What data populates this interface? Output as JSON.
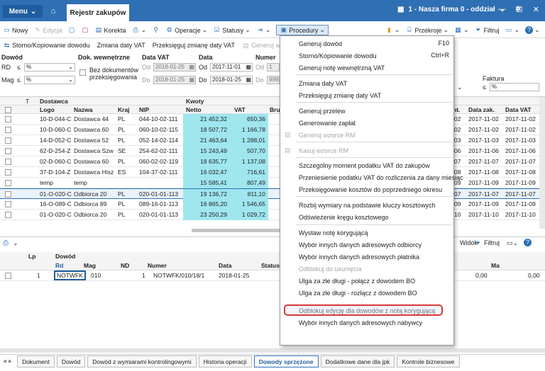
{
  "titlebar": {
    "menu": "Menu",
    "tab": "Rejestr zakupów",
    "company": "1 - Nasza firma 0 - oddział"
  },
  "toolbar": {
    "items": [
      "Nowy",
      "Edycja",
      "Korekta",
      "Operacje",
      "Statusy",
      "Procedury",
      "Przekroje",
      "Filtruj"
    ]
  },
  "toolbar2": {
    "items": [
      "Storno/Kopiowanie dowodu",
      "Zmiana daty VAT",
      "Przeksięguj zmianę daty VAT",
      "Generuj wzorce RM"
    ]
  },
  "filters": {
    "dowod": "Dowód",
    "dok_wew": "Dok. wewnętrzne",
    "data_vat": "Data VAT",
    "data": "Data",
    "numer": "Numer",
    "rd": "RD",
    "mag": "Mag",
    "le": "≤",
    "pct": "%",
    "bez": "Bez dokumentów przeksięgowania",
    "od": "Od",
    "do": "Do",
    "dv_od": "2018-01-25",
    "dv_do": "2018-01-25",
    "d_od": "2017-11-01",
    "d_do": "2018-01-25",
    "num_od": "1",
    "num_do": "999",
    "faktura": "Faktura"
  },
  "grid": {
    "group_hdr": {
      "dostawca": "Dostawca",
      "kwoty": "Kwoty"
    },
    "headers": {
      "t": "T",
      "logo": "Logo",
      "nazwa": "Nazwa",
      "kraj": "Kraj",
      "nip": "NIP",
      "netto": "Netto",
      "vat": "VAT",
      "bru": "Bru",
      "dnr": "nt.",
      "data_zak": "Data zak.",
      "data_vat": "Data VAT"
    },
    "rows": [
      {
        "logo": "10-D-044-C",
        "nazwa": "Dostawca 44",
        "kraj": "PL",
        "nip": "044-10-02-111",
        "netto": "21 452,32",
        "vat": "650,36",
        "dn": "02",
        "dz": "2017-11-02",
        "dv": "2017-11-02"
      },
      {
        "logo": "10-D-060-C",
        "nazwa": "Dostawca 60",
        "kraj": "PL",
        "nip": "060-10-02-115",
        "netto": "18 507,72",
        "vat": "1 166,78",
        "dn": "02",
        "dz": "2017-11-02",
        "dv": "2017-11-02"
      },
      {
        "logo": "14-D-052-C",
        "nazwa": "Dostawca 52",
        "kraj": "PL",
        "nip": "052-14-02-114",
        "netto": "21 463,64",
        "vat": "1 288,01",
        "dn": "03",
        "dz": "2017-11-03",
        "dv": "2017-11-03"
      },
      {
        "logo": "62-D-254-Z",
        "nazwa": "Dostawca Szw",
        "kraj": "SE",
        "nip": "254-62-02-111",
        "netto": "15 243,49",
        "vat": "507,70",
        "dn": "06",
        "dz": "2017-11-06",
        "dv": "2017-11-06"
      },
      {
        "logo": "02-D-060-C",
        "nazwa": "Dostawca 60",
        "kraj": "PL",
        "nip": "060-02-02-119",
        "netto": "18 635,77",
        "vat": "1 137,08",
        "dn": "07",
        "dz": "2017-11-07",
        "dv": "2017-11-07"
      },
      {
        "logo": "37-D-104-Z",
        "nazwa": "Dostawca Hisz",
        "kraj": "ES",
        "nip": "104-37-02-111",
        "netto": "16 032,47",
        "vat": "716,61",
        "dn": "08",
        "dz": "2017-11-08",
        "dv": "2017-11-08"
      },
      {
        "logo": "temp",
        "nazwa": "temp",
        "kraj": "",
        "nip": "",
        "netto": "15 585,41",
        "vat": "807,49",
        "dn": "09",
        "dz": "2017-11-09",
        "dv": "2017-11-09"
      },
      {
        "logo": "01-O-020-C",
        "nazwa": "Odbiorca 20",
        "kraj": "PL",
        "nip": "020-01-01-113",
        "netto": "19 136,72",
        "vat": "811,10",
        "dn": "07",
        "dz": "2017-11-07",
        "dv": "2017-11-07"
      },
      {
        "logo": "16-O-089-C",
        "nazwa": "Odbiorca 89",
        "kraj": "PL",
        "nip": "089-16-01-113",
        "netto": "16 865,20",
        "vat": "1 546,65",
        "dn": "09",
        "dz": "2017-11-09",
        "dv": "2017-11-09"
      },
      {
        "logo": "01-O-020-C",
        "nazwa": "Odbiorca 20",
        "kraj": "PL",
        "nip": "020-01-01-113",
        "netto": "23 250,29",
        "vat": "1 029,72",
        "dn": "10",
        "dz": "2017-11-10",
        "dv": "2017-11-10"
      }
    ]
  },
  "sec2": {
    "widok": "Widok",
    "filtruj": "Filtruj"
  },
  "grid2": {
    "headers": {
      "lp": "Lp",
      "dowod": "Dowód",
      "rd": "Rd",
      "mag": "Mag",
      "nd": "ND",
      "numer": "Numer",
      "data": "Data",
      "status": "Status",
      "ma": "Ma"
    },
    "row": {
      "lp": "1",
      "rd": "NOTWFK",
      "mag": "010",
      "nd": "1",
      "numer": "NOTWFK/010/18/1",
      "data": "2018-01-25",
      "v1": "0,00",
      "v2": "0,00"
    }
  },
  "bottomtabs": [
    "Dokument",
    "Dowód",
    "Dowód z wymiarami kontrolingowymi",
    "Historia operacji",
    "Dowody sprzężone",
    "Dodatkowe dane dla jpk",
    "Kontrole biznesowe"
  ],
  "menu": {
    "items": [
      {
        "label": "Generuj dowód",
        "shortcut": "F10",
        "state": "enabled"
      },
      {
        "label": "Storno/Kopiowanie dowodu",
        "shortcut": "Ctrl+R",
        "state": "enabled"
      },
      {
        "label": "Generuj notę wewnętrzną VAT",
        "shortcut": "",
        "state": "enabled"
      },
      {
        "label": "Zmiana daty VAT",
        "shortcut": "",
        "state": "enabled"
      },
      {
        "label": "Przeksięguj zmianę daty VAT",
        "shortcut": "",
        "state": "enabled"
      },
      {
        "label": "Generuj przelew",
        "shortcut": "",
        "state": "enabled"
      },
      {
        "label": "Generowanie zapłat",
        "shortcut": "",
        "state": "enabled"
      },
      {
        "label": "Generuj wzorce RM",
        "shortcut": "",
        "state": "disabled"
      },
      {
        "label": "Kasuj wzorce RM",
        "shortcut": "",
        "state": "disabled"
      },
      {
        "label": "Szczególny moment podatku VAT do zakupów",
        "shortcut": "",
        "state": "enabled"
      },
      {
        "label": "Przeniesienie podatku VAT do rozliczenia za dany miesiąc",
        "shortcut": "",
        "state": "enabled"
      },
      {
        "label": "Przeksięgowanie kosztów do poprzedniego okresu",
        "shortcut": "",
        "state": "enabled"
      },
      {
        "label": "Rozbij wymiary na podstawie kluczy kosztowych",
        "shortcut": "",
        "state": "enabled"
      },
      {
        "label": "Odświeżenie kręgu kosztowego",
        "shortcut": "",
        "state": "enabled"
      },
      {
        "label": "Wystaw notę korygującą",
        "shortcut": "",
        "state": "enabled"
      },
      {
        "label": "Wybór innych danych adresowych odbiorcy",
        "shortcut": "",
        "state": "enabled"
      },
      {
        "label": "Wybór innych danych adresowych płatnika",
        "shortcut": "",
        "state": "enabled"
      },
      {
        "label": "Odblokuj do usunięcia",
        "shortcut": "",
        "state": "disabled"
      },
      {
        "label": "Ulga za złe długi - połącz z dowodem BO",
        "shortcut": "",
        "state": "enabled"
      },
      {
        "label": "Ulga za złe długi - rozłącz z dowodem BO",
        "shortcut": "",
        "state": "enabled"
      },
      {
        "label": "Odblokuj edycję dla dowodów z notą korygującą",
        "shortcut": "",
        "state": "highlighted"
      },
      {
        "label": "Wybór innych danych adresowych nabywcy",
        "shortcut": "",
        "state": "enabled"
      }
    ]
  },
  "colors": {
    "titlebar": "#2f6fb3",
    "kwoty_bg": "#9fe6ef",
    "highlight_border": "#d93a3a"
  }
}
